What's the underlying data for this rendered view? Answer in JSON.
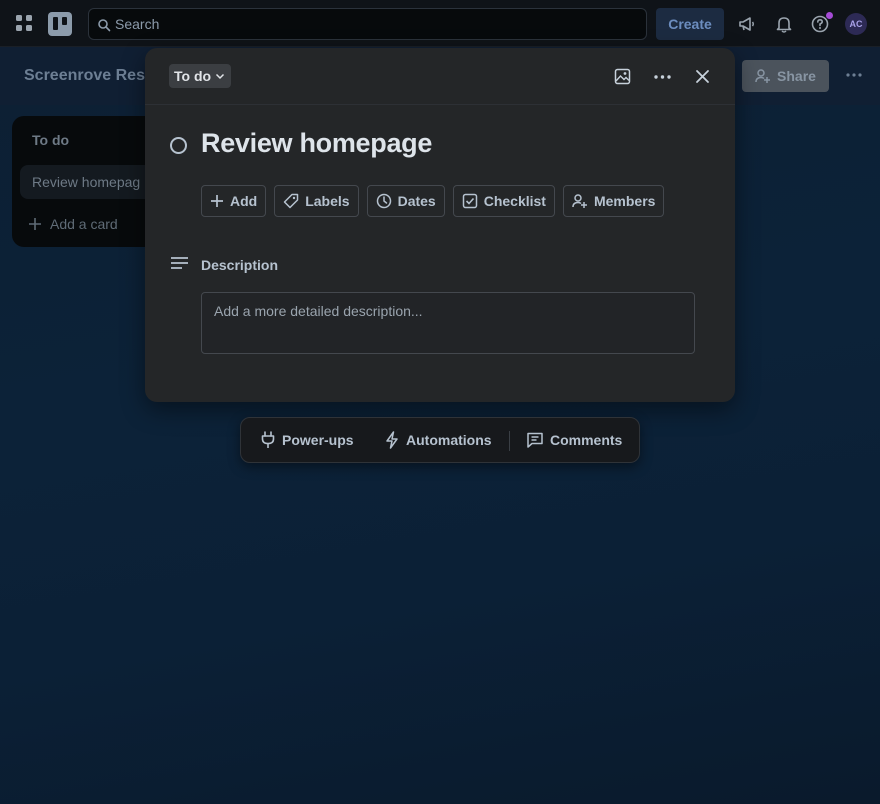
{
  "topbar": {
    "search_placeholder": "Search",
    "create_label": "Create",
    "avatar_initials": "AC",
    "notification_dot_color": "#a54bd6"
  },
  "board": {
    "title": "Screenrove Res",
    "share_label": "Share"
  },
  "list": {
    "title": "To do",
    "cards": [
      {
        "title": "Review homepag"
      }
    ],
    "add_card_label": "Add a card"
  },
  "modal": {
    "list_name": "To do",
    "card_title": "Review homepage",
    "actions": [
      {
        "label": "Add",
        "icon": "plus-icon"
      },
      {
        "label": "Labels",
        "icon": "tag-icon"
      },
      {
        "label": "Dates",
        "icon": "clock-icon"
      },
      {
        "label": "Checklist",
        "icon": "checkbox-icon"
      },
      {
        "label": "Members",
        "icon": "add-member-icon"
      }
    ],
    "description_label": "Description",
    "description_placeholder": "Add a more detailed description..."
  },
  "floating_bar": {
    "items": [
      {
        "label": "Power-ups",
        "icon": "plug-icon"
      },
      {
        "label": "Automations",
        "icon": "lightning-icon"
      },
      {
        "label": "Comments",
        "icon": "comment-icon"
      }
    ]
  }
}
